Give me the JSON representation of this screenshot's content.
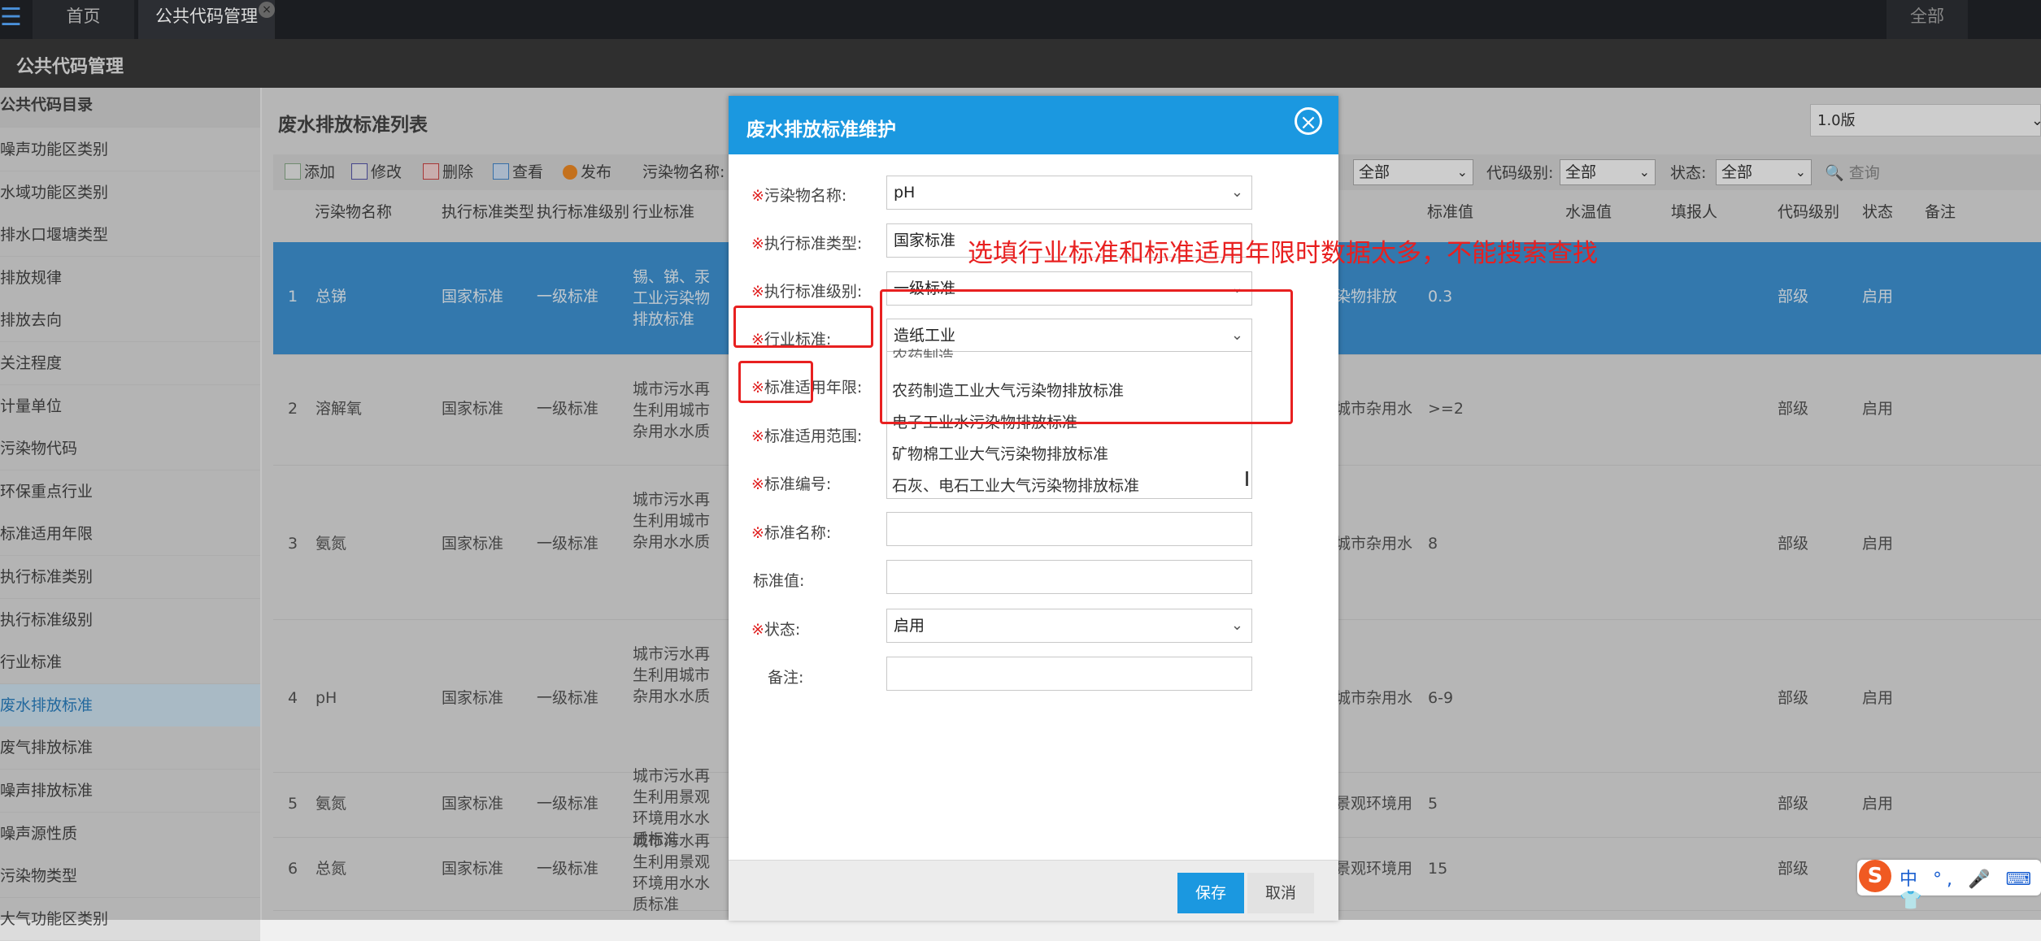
{
  "topbar": {
    "menu_icon": "list-icon",
    "tabs": [
      "首页",
      "公共代码管理"
    ],
    "close_icon": "close-icon",
    "right_label": "全部"
  },
  "header": {
    "title": "公共代码管理"
  },
  "sidebar": {
    "title": "公共代码目录",
    "items": [
      "噪声功能区类别",
      "水域功能区类别",
      "排水口堰塘类型",
      "排放规律",
      "排放去向",
      "关注程度",
      "计量单位",
      "污染物代码",
      "环保重点行业",
      "标准适用年限",
      "执行标准类别",
      "执行标准级别",
      "行业标准",
      "废水排放标准",
      "废气排放标准",
      "噪声排放标准",
      "噪声源性质",
      "污染物类型",
      "大气功能区类别"
    ],
    "selected": "废水排放标准"
  },
  "main": {
    "list_title": "废水排放标准列表",
    "version": "1.0版",
    "toolbar": {
      "add": "添加",
      "edit": "修改",
      "delete": "删除",
      "view": "查看",
      "publish": "发布",
      "pollutant_label": "污染物名称:"
    },
    "filters": {
      "first_select": "全部",
      "code_level_label": "代码级别:",
      "code_level": "全部",
      "status_label": "状态:",
      "status": "全部",
      "query": "查询"
    },
    "columns_left": [
      "污染物名称",
      "执行标准类型",
      "执行标准级别",
      "行业标准"
    ],
    "columns_right": [
      "标准值",
      "水温值",
      "填报人",
      "代码级别",
      "状态",
      "备注"
    ],
    "rows": [
      {
        "no": "1",
        "name": "总锑",
        "type": "国家标准",
        "level": "一级标准",
        "industry": "锡、锑、汞工业污染物排放标准",
        "std_name": "染物排放",
        "value": "0.3",
        "code_level": "部级",
        "status": "启用"
      },
      {
        "no": "2",
        "name": "溶解氧",
        "type": "国家标准",
        "level": "一级标准",
        "industry": "城市污水再生利用城市杂用水水质",
        "std_name": "城市杂用水",
        "value": ">=2",
        "code_level": "部级",
        "status": "启用"
      },
      {
        "no": "3",
        "name": "氨氮",
        "type": "国家标准",
        "level": "一级标准",
        "industry": "城市污水再生利用城市杂用水水质",
        "std_name": "城市杂用水",
        "value": "8",
        "code_level": "部级",
        "status": "启用"
      },
      {
        "no": "4",
        "name": "pH",
        "type": "国家标准",
        "level": "一级标准",
        "industry": "城市污水再生利用城市杂用水水质",
        "std_name": "城市杂用水",
        "value": "6-9",
        "code_level": "部级",
        "status": "启用"
      },
      {
        "no": "5",
        "name": "氨氮",
        "type": "国家标准",
        "level": "一级标准",
        "industry": "城市污水再生利用景观环境用水水质标准",
        "std_name": "景观环境用",
        "value": "5",
        "code_level": "部级",
        "status": "启用"
      },
      {
        "no": "6",
        "name": "总氮",
        "type": "国家标准",
        "level": "一级标准",
        "industry": "城市污水再生利用景观环境用水水质标准",
        "std_name": "景观环境用",
        "value": "15",
        "code_level": "部级",
        "status": ""
      }
    ]
  },
  "dialog": {
    "title": "废水排放标准维护",
    "required_mark": "※",
    "fields": {
      "pollutant": {
        "label": "污染物名称:",
        "value": "pH"
      },
      "std_type": {
        "label": "执行标准类型:",
        "value": "国家标准"
      },
      "std_level": {
        "label": "执行标准级别:",
        "value": "一级标准"
      },
      "industry": {
        "label": "行业标准:",
        "value": "造纸工业"
      },
      "years": {
        "label": "标准适用年限:"
      },
      "scope": {
        "label": "标准适用范围:"
      },
      "std_no": {
        "label": "标准编号:"
      },
      "std_name": {
        "label": "标准名称:",
        "value": ""
      },
      "std_value": {
        "label": "标准值:",
        "value": ""
      },
      "status": {
        "label": "状态:",
        "value": "启用"
      },
      "remark": {
        "label": "备注:",
        "value": ""
      }
    },
    "dropdown_items": [
      "农药制造",
      "农药制造工业大气污染物排放标准",
      "电子工业水污染物排放标准",
      "矿物棉工业大气污染物排放标准",
      "石灰、电石工业大气污染物排放标准"
    ],
    "save": "保存",
    "cancel": "取消"
  },
  "annotation": {
    "note": "选填行业标准和标准适用年限时数据太多，不能搜索查找",
    "color": "#e82020"
  },
  "ime": {
    "logo": "S",
    "text": "中 °, 🎤 ⌨ 👕"
  }
}
